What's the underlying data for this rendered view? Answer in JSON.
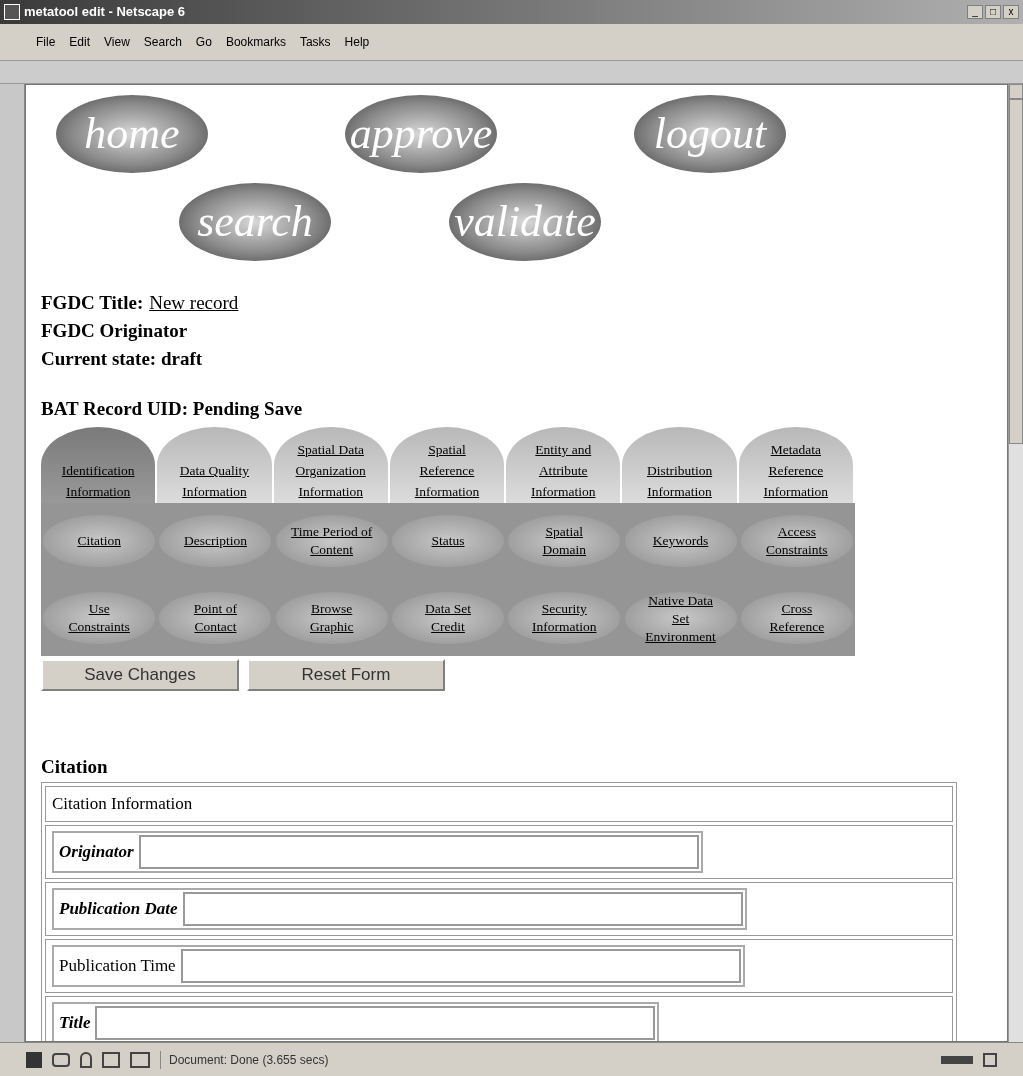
{
  "window": {
    "title": "metatool edit - Netscape 6",
    "controls": [
      "_",
      "□",
      "x"
    ]
  },
  "menu": [
    "File",
    "Edit",
    "View",
    "Search",
    "Go",
    "Bookmarks",
    "Tasks",
    "Help"
  ],
  "nav_buttons": [
    {
      "label": "home"
    },
    {
      "label": "approve"
    },
    {
      "label": "logout"
    },
    {
      "label": "search"
    },
    {
      "label": "validate"
    }
  ],
  "record": {
    "title_label": "FGDC Title:",
    "title_link": "New record",
    "originator": "FGDC Originator",
    "state": "Current state: draft",
    "uid": "BAT Record UID: Pending Save"
  },
  "tabs": [
    {
      "label": "Identification\nInformation",
      "selected": true
    },
    {
      "label": "Data Quality\nInformation",
      "selected": false
    },
    {
      "label": "Spatial Data\nOrganization\nInformation",
      "selected": false
    },
    {
      "label": "Spatial\nReference\nInformation",
      "selected": false
    },
    {
      "label": "Entity and\nAttribute\nInformation",
      "selected": false
    },
    {
      "label": "Distribution\nInformation",
      "selected": false
    },
    {
      "label": "Metadata\nReference\nInformation",
      "selected": false
    }
  ],
  "subtabs": [
    "Citation",
    "Description",
    "Time Period of\nContent",
    "Status",
    "Spatial\nDomain",
    "Keywords",
    "Access\nConstraints",
    "Use\nConstraints",
    "Point of\nContact",
    "Browse\nGraphic",
    "Data Set\nCredit",
    "Security\nInformation",
    "Native Data\nSet\nEnvironment",
    "Cross\nReference"
  ],
  "form_buttons": [
    "Save Changes",
    "Reset Form"
  ],
  "section": {
    "heading": "Citation",
    "header": "Citation Information",
    "fields": [
      {
        "label": "Originator",
        "required": true
      },
      {
        "label": "Publication Date",
        "required": true
      },
      {
        "label": "Publication Time",
        "required": false
      },
      {
        "label": "Title",
        "required": true
      }
    ]
  },
  "status_bar": {
    "text": "Document: Done (3.655 secs)"
  }
}
